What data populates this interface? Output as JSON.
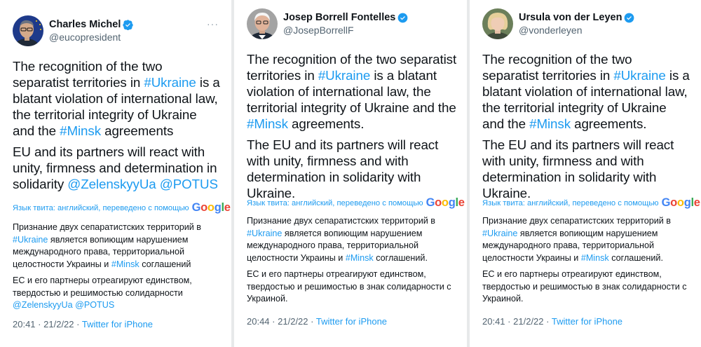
{
  "accent_color": "#1d9bf0",
  "tweets": [
    {
      "name": "Charles Michel",
      "handle": "@eucopresident",
      "more": "···",
      "avatar_icon": "portrait-man-glasses-eu-flag",
      "paragraphs": [
        [
          {
            "t": "The recognition of the two separatist territories in "
          },
          {
            "t": "#Ukraine",
            "link": true
          },
          {
            "t": " is a blatant violation of international law, the territorial integrity of Ukraine and the "
          },
          {
            "t": "#Minsk",
            "link": true
          },
          {
            "t": " agreements"
          }
        ],
        [
          {
            "t": "EU and its partners will react with unity, firmness and determination in solidarity "
          },
          {
            "t": "@ZelenskyyUa",
            "link": true
          },
          {
            "t": " "
          },
          {
            "t": "@POTUS",
            "link": true
          }
        ]
      ],
      "translation_label": "Язык твита: английский, переведено с помощью",
      "google": [
        "G",
        "o",
        "o",
        "g",
        "l",
        "e"
      ],
      "translation": [
        [
          {
            "t": "Признание двух сепаратистских территорий в "
          },
          {
            "t": "#Ukraine",
            "link": true
          },
          {
            "t": " является вопиющим нарушением международного права, территориальной целостности Украины и "
          },
          {
            "t": "#Minsk",
            "link": true
          },
          {
            "t": " соглашений"
          }
        ],
        [
          {
            "t": " ЕС и его партнеры отреагируют единством, твердостью и решимостью солидарности "
          },
          {
            "t": "@ZelenskyyUa",
            "link": true
          },
          {
            "t": " "
          },
          {
            "t": "@POTUS",
            "link": true
          }
        ]
      ],
      "time": "20:41",
      "date": "21/2/22",
      "dot": "·",
      "source": "Twitter for iPhone"
    },
    {
      "name": "Josep Borrell Fontelles",
      "handle": "@JosepBorrellF",
      "more": "···",
      "avatar_icon": "portrait-man-white-hair",
      "paragraphs": [
        [
          {
            "t": "The recognition of the two separatist territories in "
          },
          {
            "t": "#Ukraine",
            "link": true
          },
          {
            "t": " is a blatant violation of international law, the territorial integrity of Ukraine and the "
          },
          {
            "t": "#Minsk",
            "link": true
          },
          {
            "t": " agreements."
          }
        ],
        [
          {
            "t": "The EU and its partners will react with unity, firmness and with determination in solidarity with Ukraine."
          }
        ]
      ],
      "translation_label": "Язык твита: английский, переведено с помощью",
      "google": [
        "G",
        "o",
        "o",
        "g",
        "l",
        "e"
      ],
      "translation": [
        [
          {
            "t": "Признание двух сепаратистских территорий в "
          },
          {
            "t": "#Ukraine",
            "link": true
          },
          {
            "t": " является вопиющим нарушением международного права, территориальной целостности Украины и "
          },
          {
            "t": "#Minsk",
            "link": true
          },
          {
            "t": " соглашений."
          }
        ],
        [
          {
            "t": " ЕС и его партнеры отреагируют единством, твердостью и решимостью в знак солидарности с Украиной."
          }
        ]
      ],
      "time": "20:44",
      "date": "21/2/22",
      "dot": "·",
      "source": "Twitter for iPhone"
    },
    {
      "name": "Ursula von der Leyen",
      "handle": "@vonderleyen",
      "more": "···",
      "avatar_icon": "portrait-woman-blonde",
      "paragraphs": [
        [
          {
            "t": "The recognition of the two separatist territories in "
          },
          {
            "t": "#Ukraine",
            "link": true
          },
          {
            "t": " is a blatant violation of international law, the territorial integrity of Ukraine and the "
          },
          {
            "t": "#Minsk",
            "link": true
          },
          {
            "t": " agreements."
          }
        ],
        [
          {
            "t": "The EU and its partners will react with unity, firmness and with determination in solidarity with Ukraine."
          }
        ]
      ],
      "translation_label": "Язык твита: английский, переведено с помощью",
      "google": [
        "G",
        "o",
        "o",
        "g",
        "l",
        "e"
      ],
      "translation": [
        [
          {
            "t": "Признание двух сепаратистских территорий в "
          },
          {
            "t": "#Ukraine",
            "link": true
          },
          {
            "t": " является вопиющим нарушением международного права, территориальной целостности Украины и "
          },
          {
            "t": "#Minsk",
            "link": true
          },
          {
            "t": " соглашений."
          }
        ],
        [
          {
            "t": " ЕС и его партнеры отреагируют единством, твердостью и решимостью в знак солидарности с Украиной."
          }
        ]
      ],
      "time": "20:41",
      "date": "21/2/22",
      "dot": "·",
      "source": "Twitter for iPhone"
    }
  ]
}
